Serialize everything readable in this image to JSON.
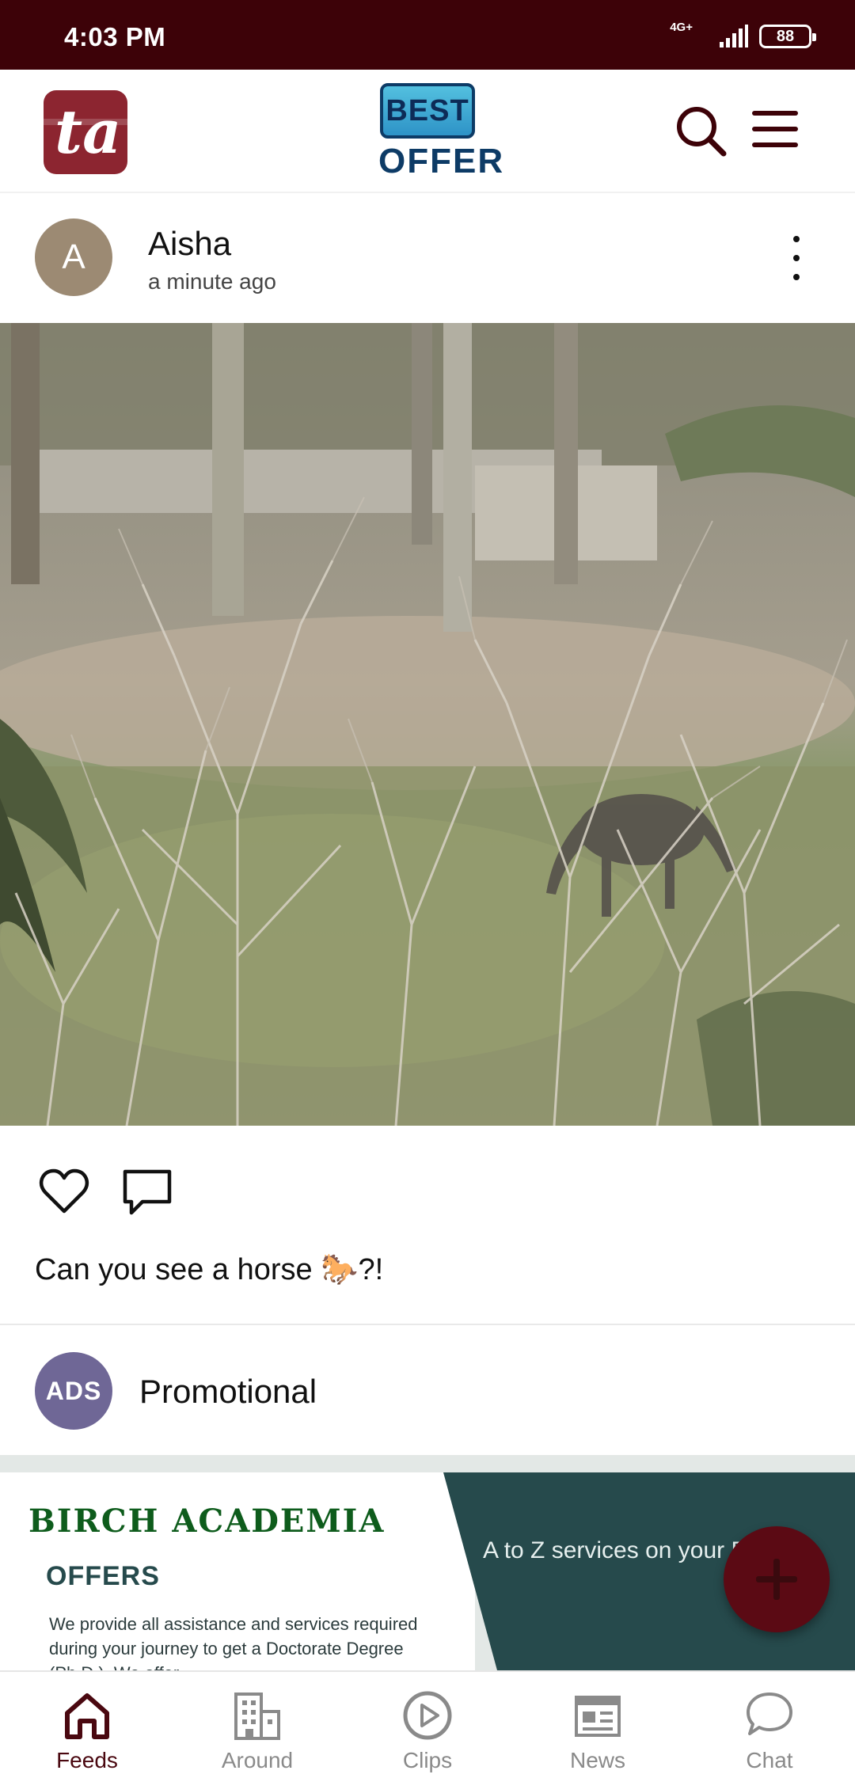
{
  "status_bar": {
    "time": "4:03 PM",
    "network": "4G+",
    "battery": "88"
  },
  "header": {
    "app_logo": "ta",
    "brand_top": "BEST",
    "brand_bottom": "OFFER"
  },
  "post": {
    "avatar_letter": "A",
    "author": "Aisha",
    "time": "a minute ago",
    "caption": "Can you see a horse 🐎?!"
  },
  "promo": {
    "avatar_text": "ADS",
    "label": "Promotional",
    "ad": {
      "title": "BIRCH ACADEMIA",
      "subtitle": "OFFERS",
      "description": "We provide all assistance and services required during your journey to get a Doctorate Degree (Ph.D.). We offer",
      "right_text": "A to Z services on your Ph.D."
    }
  },
  "bottom_nav": {
    "items": [
      {
        "label": "Feeds",
        "icon": "home-icon",
        "active": true
      },
      {
        "label": "Around",
        "icon": "building-icon"
      },
      {
        "label": "Clips",
        "icon": "play-icon"
      },
      {
        "label": "News",
        "icon": "newspaper-icon"
      },
      {
        "label": "Chat",
        "icon": "chat-icon"
      }
    ]
  },
  "colors": {
    "status_bar": "#3d0208",
    "accent": "#5b0a14",
    "active_nav": "#4a0810",
    "inactive_nav": "#8a8a8a"
  }
}
